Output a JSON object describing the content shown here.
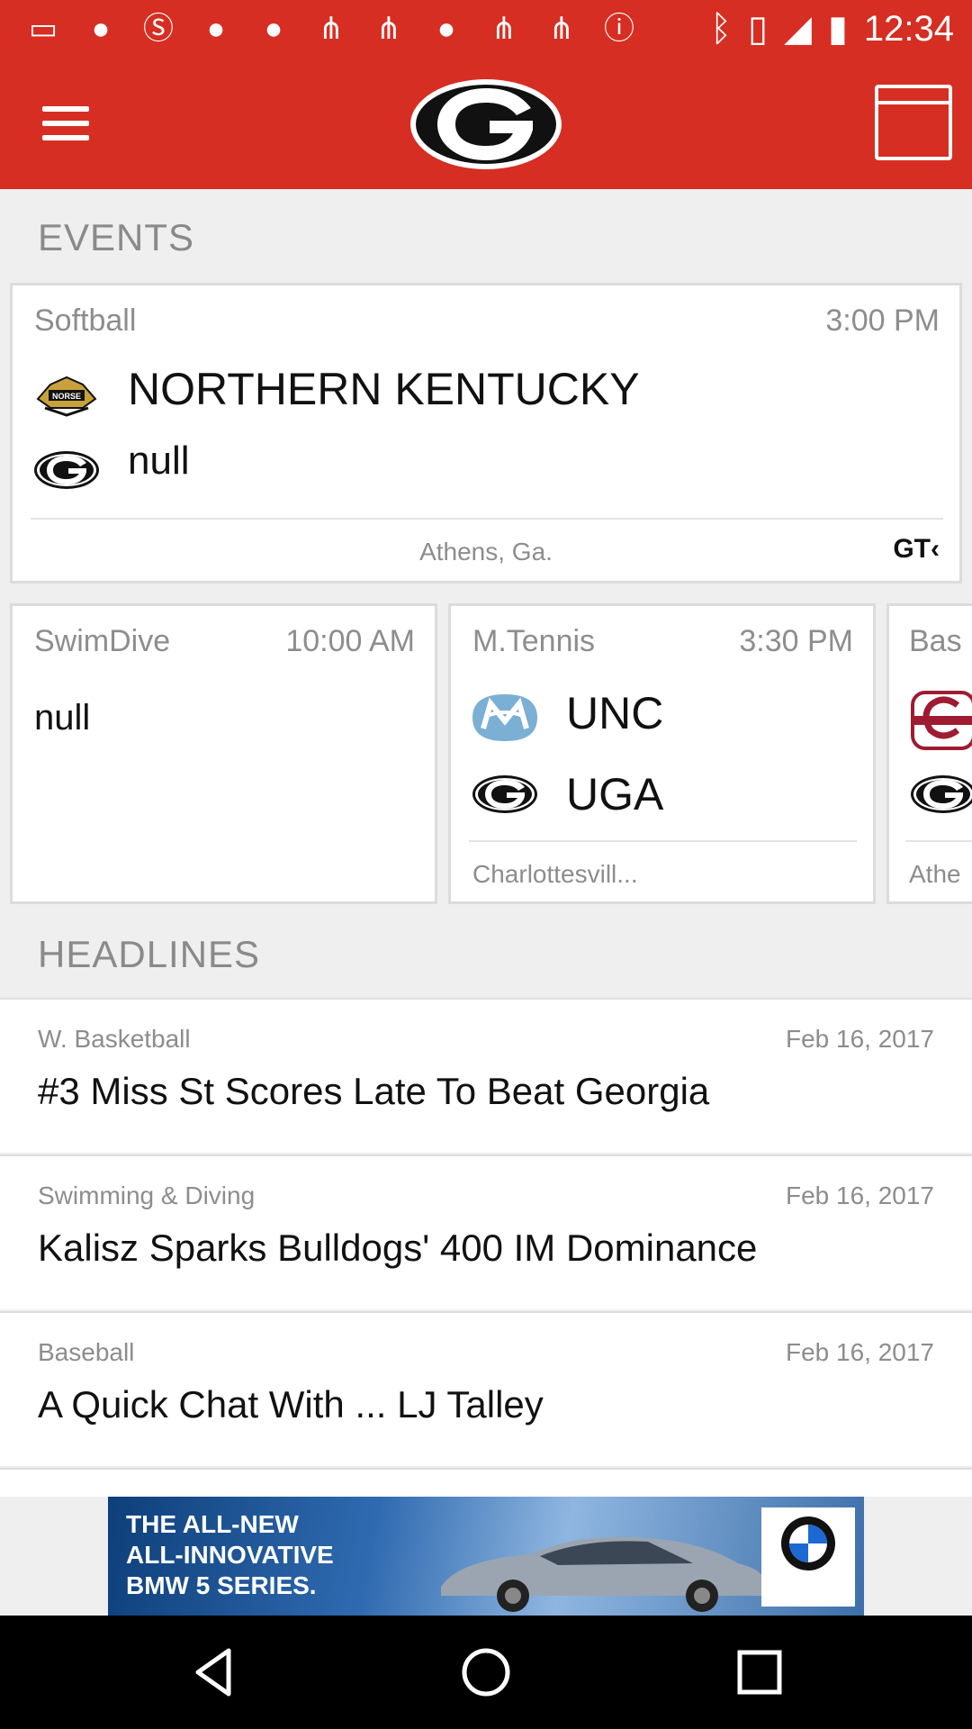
{
  "status_bar": {
    "time": "12:34",
    "left_icons": [
      "message-icon",
      "circle-icon",
      "s-app-icon",
      "circle-icon",
      "circle-icon",
      "bird-icon",
      "bird-icon",
      "circle-icon",
      "bird-icon",
      "bird-icon",
      "alert-icon"
    ],
    "right_icons": [
      "bluetooth-icon",
      "vibrate-icon",
      "signal-icon",
      "battery-icon"
    ]
  },
  "app_bar": {
    "logo_letter": "G"
  },
  "events": {
    "title": "EVENTS",
    "featured": {
      "sport": "Softball",
      "time": "3:00 PM",
      "home_team": "NORTHERN KENTUCKY",
      "away_team": "null",
      "location": "Athens, Ga.",
      "sponsor": "GT‹"
    },
    "cards": [
      {
        "sport": "SwimDive",
        "time": "10:00 AM",
        "team": "null"
      },
      {
        "sport": "M.Tennis",
        "time": "3:30 PM",
        "team1": "UNC",
        "team2": "UGA",
        "location": "Charlottesvill..."
      },
      {
        "sport": "Bas",
        "location": "Athe"
      }
    ]
  },
  "headlines": {
    "title": "HEADLINES",
    "items": [
      {
        "sport": "W. Basketball",
        "date": "Feb 16, 2017",
        "title": "#3 Miss St Scores Late To Beat Georgia"
      },
      {
        "sport": "Swimming & Diving",
        "date": "Feb 16, 2017",
        "title": "Kalisz Sparks Bulldogs' 400 IM Dominance"
      },
      {
        "sport": "Baseball",
        "date": "Feb 16, 2017",
        "title": "A Quick Chat With ... LJ Talley"
      }
    ]
  },
  "ad": {
    "line1": "THE ALL-NEW",
    "line2": "ALL-INNOVATIVE",
    "line3": "BMW 5 SERIES."
  },
  "colors": {
    "brand_red": "#d62e22",
    "unc_blue": "#7bafd4"
  }
}
